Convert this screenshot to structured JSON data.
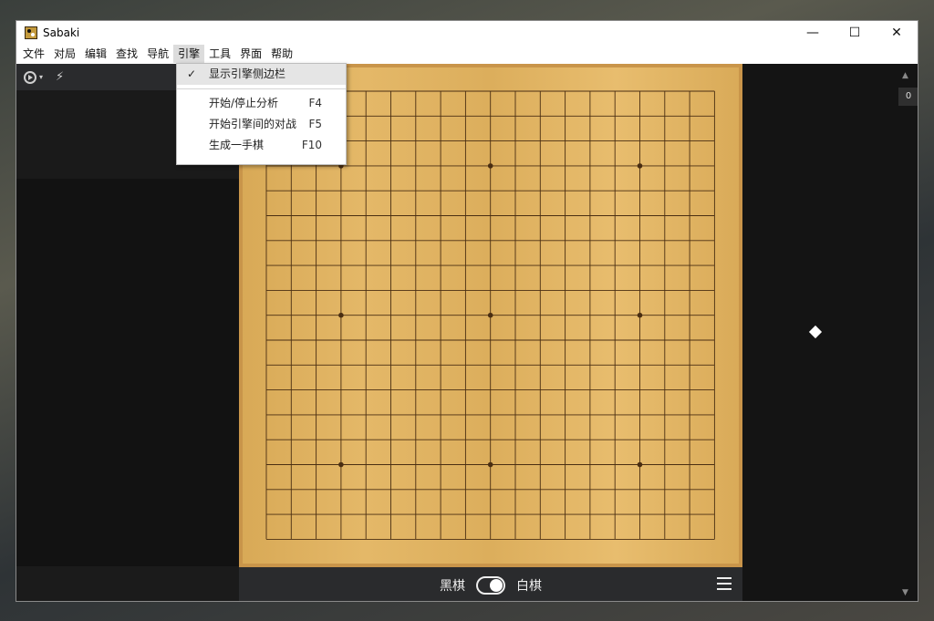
{
  "window": {
    "title": "Sabaki"
  },
  "window_controls": {
    "minimize": "—",
    "maximize": "☐",
    "close": "✕"
  },
  "menu": [
    {
      "label": "文件"
    },
    {
      "label": "对局"
    },
    {
      "label": "编辑"
    },
    {
      "label": "查找"
    },
    {
      "label": "导航"
    },
    {
      "label": "引擎",
      "active": true
    },
    {
      "label": "工具"
    },
    {
      "label": "界面"
    },
    {
      "label": "帮助"
    }
  ],
  "dropdown": {
    "items": [
      {
        "label": "显示引擎侧边栏",
        "checked": true,
        "shortcut": ""
      },
      {
        "separator": true
      },
      {
        "label": "开始/停止分析",
        "shortcut": "F4"
      },
      {
        "label": "开始引擎间的对战",
        "shortcut": "F5"
      },
      {
        "label": "生成一手棋",
        "shortcut": "F10"
      }
    ],
    "check_mark": "✓"
  },
  "left_toolbar": {
    "play_icon": "play-circle-icon",
    "caret": "▾",
    "bolt": "⚡"
  },
  "board": {
    "size": 19,
    "star_points": [
      [
        3,
        3
      ],
      [
        3,
        9
      ],
      [
        3,
        15
      ],
      [
        9,
        3
      ],
      [
        9,
        9
      ],
      [
        9,
        15
      ],
      [
        15,
        3
      ],
      [
        15,
        9
      ],
      [
        15,
        15
      ]
    ]
  },
  "bottom_bar": {
    "black_label": "黑棋",
    "white_label": "白棋"
  },
  "right_panel": {
    "move_count": "0",
    "scroll_up": "▲",
    "scroll_down": "▼"
  },
  "colors": {
    "board_wood": "#e2b565",
    "grid_line": "#4a2e12",
    "dark_panel": "#151515",
    "toolbar": "#2a2b2d"
  }
}
